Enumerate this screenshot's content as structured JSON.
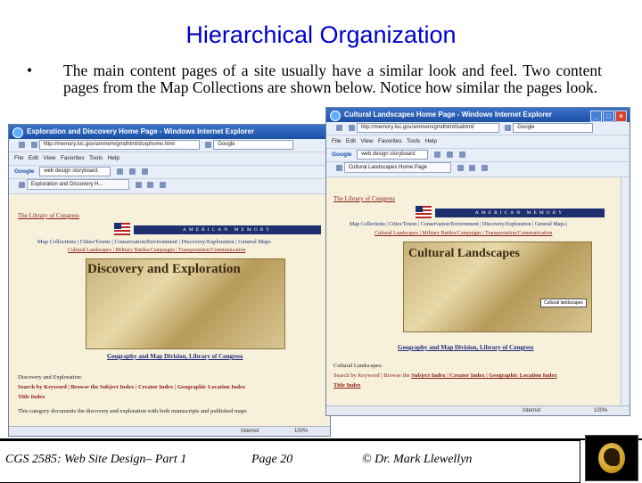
{
  "slide": {
    "title": "Hierarchical Organization",
    "bullet_symbol": "•",
    "bullet_text": "The main content pages of a site usually have a similar look and feel. Two content pages from the Map Collections are shown below. Notice how similar the pages look."
  },
  "left_window": {
    "title": "Exploration and Discovery Home Page - Windows Internet Explorer",
    "address": "http://memory.loc.gov/ammem/gmdhtml/dsxphome.html",
    "search_engine": "Google",
    "menu": [
      "File",
      "Edit",
      "View",
      "Favorites",
      "Tools",
      "Help"
    ],
    "google_query": "web design storyboard",
    "tab_label": "Exploration and Discovery H...",
    "loc_link": "The Library of Congress",
    "banner": "AMERICAN MEMORY",
    "nav_primary": "Map Collections | Cities/Towns | Conservation/Environment | Discovery/Exploration | General Maps",
    "nav_secondary": "Cultural Landscapes | Military Battles/Campaigns | Transportation/Communication",
    "feature_title": "Discovery and Exploration",
    "division_link": "Geography and Map Division, Library of Congress",
    "section_heading": "Discovery and Exploration:",
    "search_line": "Search by Keyword | Browse the Subject Index | Creator Index | Geographic Location Index",
    "title_index": "Title Index",
    "description": "This category documents the discovery and exploration with both manuscripts and published maps",
    "status_zone": "Internet",
    "zoom": "100%"
  },
  "right_window": {
    "title": "Cultural Landscapes Home Page - Windows Internet Explorer",
    "address": "http://memory.loc.gov/ammem/gmdhtml/lsahtml/",
    "search_engine": "Google",
    "menu": [
      "File",
      "Edit",
      "View",
      "Favorites",
      "Tools",
      "Help"
    ],
    "google_query": "web design storyboard",
    "tab_label": "Cultural Landscapes Home Page",
    "loc_link": "The Library of Congress",
    "banner": "AMERICAN MEMORY",
    "nav_primary": "Map Collections | Cities/Towns | Conservation/Environment | Discovery/Exploration | General Maps |",
    "nav_secondary": "Cultural Landscapes | Military Battles/Campaigns | Transportation/Communication",
    "feature_title": "Cultural Landscapes",
    "caption": "Cultural landscapes",
    "division_link": "Geography and Map Division, Library of Congress",
    "section_heading": "Cultural Landscapes:",
    "search_line_prefix": "Search by Keyword | Browse the",
    "search_links": "Subject Index | Creator Index | Geographic Location Index",
    "title_index": "Title Index",
    "status_zone": "Internet",
    "zoom": "100%"
  },
  "footer": {
    "course": "CGS 2585: Web Site Design– Part 1",
    "page": "Page 20",
    "author": "© Dr. Mark Llewellyn"
  },
  "colors": {
    "title_blue": "#0000cc",
    "ie_title_blue": "#1c4fa6",
    "loc_red": "#8a1d14",
    "page_bg": "#f7f1dc"
  }
}
